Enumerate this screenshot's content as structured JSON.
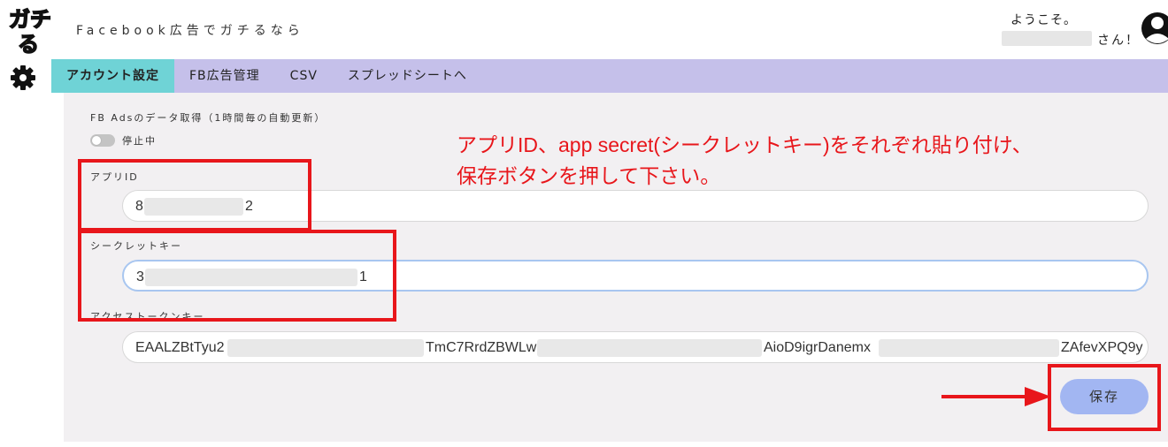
{
  "header": {
    "logo_text": "ガチる",
    "tagline": "Facebook広告でガチるなら",
    "welcome": "ようこそ。",
    "user_suffix": "さん！"
  },
  "nav": {
    "items": [
      {
        "label": "アカウント設定",
        "active": true
      },
      {
        "label": "FB広告管理",
        "active": false
      },
      {
        "label": "CSV",
        "active": false
      },
      {
        "label": "スプレッドシートへ",
        "active": false
      }
    ]
  },
  "settings": {
    "fetch_label": "FB Adsのデータ取得（1時間毎の自動更新）",
    "toggle_label": "停止中",
    "app_id_label": "アプリID",
    "app_id_value_start": "8",
    "app_id_value_end": "2",
    "secret_label": "シークレットキー",
    "secret_value_start": "3",
    "secret_value_end": "1",
    "token_label": "アクセストークンキー",
    "token_part1": "EAALZBtTyu2",
    "token_part2": "TmC7RrdZBWLw",
    "token_part3": "AioD9igrDanemx",
    "token_part4": "ZAfevXPQ9y",
    "save_label": "保存"
  },
  "annotation": {
    "line1": "アプリID、app secret(シークレットキー)をそれぞれ貼り付け、",
    "line2": "保存ボタンを押して下さい。"
  },
  "colors": {
    "nav_bg": "#c5c0ea",
    "nav_active": "#6fd3d6",
    "annotation_red": "#e8161b",
    "save_button": "#a2b6f2"
  }
}
